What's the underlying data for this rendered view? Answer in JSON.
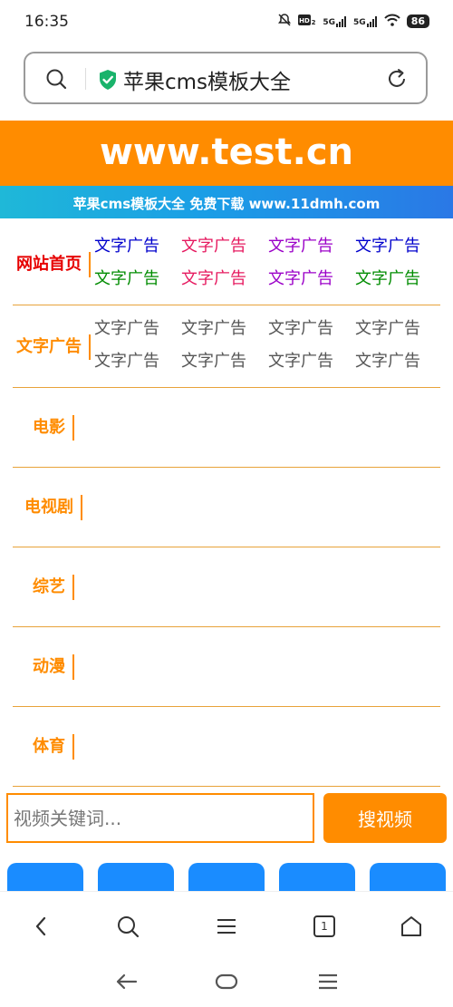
{
  "status": {
    "time": "16:35",
    "net1": "5G",
    "net2": "5G",
    "battery": "86"
  },
  "address_bar": {
    "url_text": "苹果cms模板大全"
  },
  "banner": {
    "domain": "www.test.cn",
    "strip_text": "苹果cms模板大全 免费下载 www.11dmh.com"
  },
  "colors": {
    "accent": "#ff8c00",
    "link_blue": "#0000cc",
    "link_red": "#e6195f",
    "link_purple": "#9b00c8",
    "link_green": "#008c00",
    "link_gray": "#555555",
    "label_red": "#e60000",
    "button_blue": "#1a8cff"
  },
  "nav": {
    "rows": [
      {
        "label": "网站首页",
        "links": [
          "文字广告",
          "文字广告",
          "文字广告",
          "文字广告",
          "文字广告",
          "文字广告",
          "文字广告",
          "文字广告"
        ]
      },
      {
        "label": "文字广告",
        "links": [
          "文字广告",
          "文字广告",
          "文字广告",
          "文字广告",
          "文字广告",
          "文字广告",
          "文字广告",
          "文字广告"
        ]
      },
      {
        "label": "电影"
      },
      {
        "label": "电视剧"
      },
      {
        "label": "综艺"
      },
      {
        "label": "动漫"
      },
      {
        "label": "体育"
      }
    ]
  },
  "search": {
    "placeholder": "视频关键词...",
    "button_label": "搜视频"
  },
  "toolbar": {
    "tab_count": "1"
  }
}
